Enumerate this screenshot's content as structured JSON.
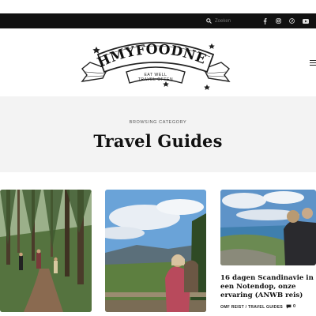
{
  "topbar": {
    "search_placeholder": "Zoeken",
    "icons": [
      "search-icon",
      "facebook-icon",
      "instagram-icon",
      "pinterest-icon",
      "youtube-icon"
    ]
  },
  "header": {
    "logo_text": "OHMYFOODNESS",
    "logo_tagline_1": "EAT WELL",
    "logo_tagline_2": "TRAVEL OFTEN"
  },
  "category": {
    "eyebrow": "Browsing Category",
    "title": "Travel Guides"
  },
  "posts": [
    {
      "image": "forest-trail-photo"
    },
    {
      "image": "mountain-view-couple-photo"
    },
    {
      "image": "scandinavia-view-photo",
      "title": "16 dagen Scandinavie in een Notendop, onze ervaring (ANWB reis)",
      "meta": "OMF Reist / Travel Guides",
      "comments": "0"
    }
  ],
  "colors": {
    "topbar": "#111111",
    "banner": "#f3f3f3",
    "text": "#111111"
  }
}
